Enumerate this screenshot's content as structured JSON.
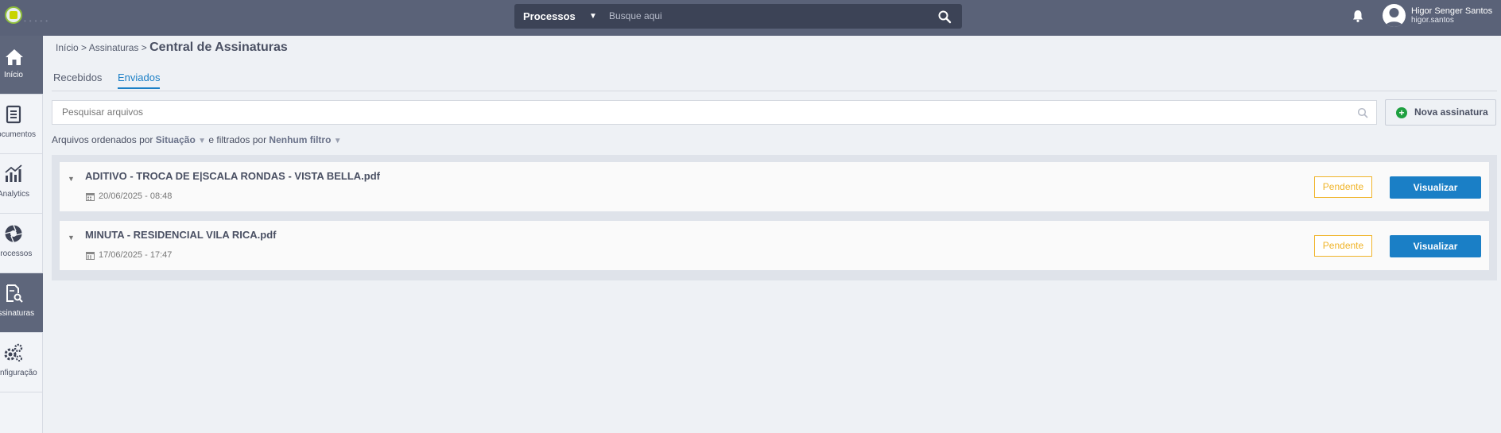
{
  "header": {
    "search_category": "Processos",
    "search_placeholder": "Busque aqui",
    "user_name": "Higor Senger Santos",
    "user_login": "higor.santos"
  },
  "sidebar": {
    "items": [
      {
        "label": "Início",
        "icon": "home-icon"
      },
      {
        "label": "Documentos",
        "icon": "document-icon"
      },
      {
        "label": "Analytics",
        "icon": "chart-icon"
      },
      {
        "label": "Processos",
        "icon": "aperture-icon"
      },
      {
        "label": "Assinaturas",
        "icon": "signature-icon"
      },
      {
        "label": "Configuração",
        "icon": "gears-icon"
      }
    ]
  },
  "breadcrumb": {
    "home": "Início",
    "parent": "Assinaturas",
    "current": "Central de Assinaturas"
  },
  "tabs": [
    {
      "label": "Recebidos"
    },
    {
      "label": "Enviados",
      "active": true
    }
  ],
  "files_search": {
    "placeholder": "Pesquisar arquivos"
  },
  "new_button": {
    "label": "Nova assinatura"
  },
  "sort": {
    "prefix": "Arquivos ordenados por",
    "order_value": "Situação",
    "middle": "e filtrados por",
    "filter_value": "Nenhum filtro"
  },
  "files": [
    {
      "name": "ADITIVO - TROCA DE E|SCALA RONDAS - VISTA BELLA.pdf",
      "date": "20/06/2025 - 08:48",
      "status": "Pendente",
      "action": "Visualizar"
    },
    {
      "name": "MINUTA - RESIDENCIAL VILA RICA.pdf",
      "date": "17/06/2025 - 17:47",
      "status": "Pendente",
      "action": "Visualizar"
    }
  ],
  "colors": {
    "topbar": "#5a6278",
    "accent": "#1a7fc6",
    "pending": "#f0b429",
    "add": "#1ea040"
  }
}
